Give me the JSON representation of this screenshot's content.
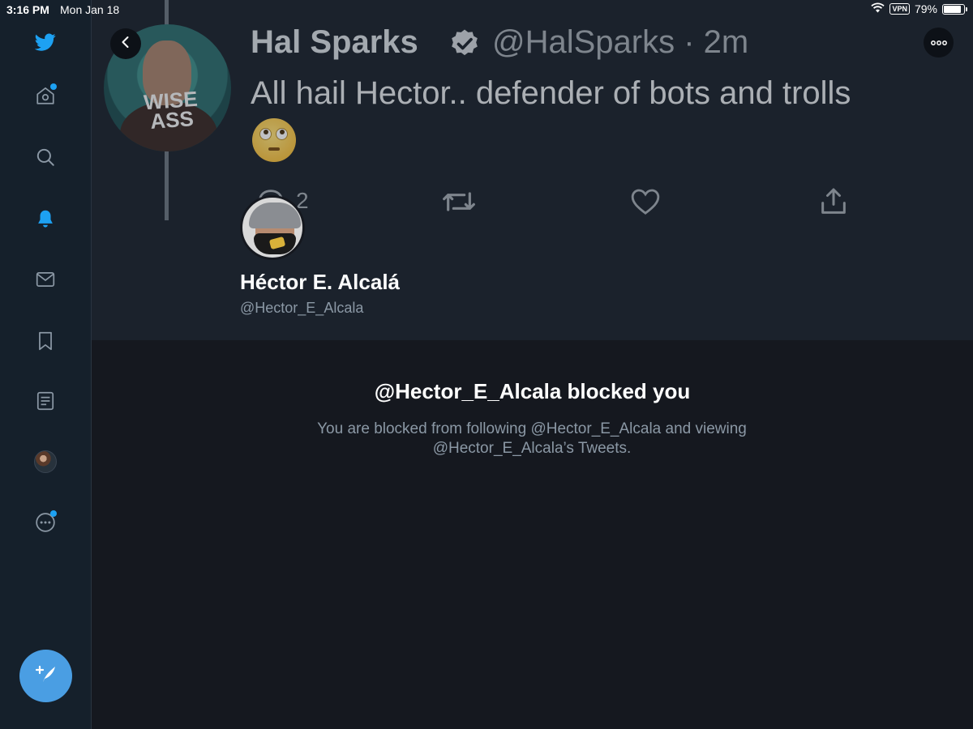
{
  "status_bar": {
    "time": "3:16 PM",
    "date": "Mon Jan 18",
    "vpn": "VPN",
    "battery": "79%",
    "battery_level": 0.79
  },
  "sidebar": {
    "items": [
      {
        "icon": "twitter-bird-icon"
      },
      {
        "icon": "home-icon",
        "badge": true
      },
      {
        "icon": "search-icon"
      },
      {
        "icon": "bell-icon",
        "active": true
      },
      {
        "icon": "mail-icon"
      },
      {
        "icon": "bookmark-icon"
      },
      {
        "icon": "lists-icon"
      },
      {
        "icon": "profile-avatar-icon"
      },
      {
        "icon": "more-icon",
        "badge": true
      }
    ],
    "compose_icon": "compose-tweet-icon"
  },
  "tweet": {
    "author_name": "Hal Sparks",
    "handle_time": "@HalSparks · 2m",
    "text": "All hail Hector.. defender of bots and trolls",
    "emoji": "face-with-rolling-eyes",
    "avatar_text_1": "WISE",
    "avatar_text_2": "ASS",
    "reply_count": "2"
  },
  "profile": {
    "name": "Héctor E. Alcalá",
    "handle": "@Hector_E_Alcala"
  },
  "blocked": {
    "title": "@Hector_E_Alcala blocked you",
    "line1": "You are blocked from following @Hector_E_Alcala and viewing",
    "line2": "@Hector_E_Alcala’s Tweets."
  },
  "colors": {
    "accent": "#1da1f2",
    "background": "#15181f",
    "sidebar": "#15202b",
    "secondary_text": "#8b98a5"
  }
}
